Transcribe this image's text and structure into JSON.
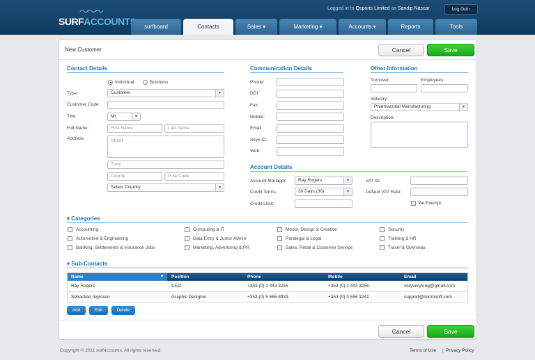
{
  "brand": {
    "name_a": "SURF",
    "name_b": "ACCOUNTS",
    "waves": "〜〜〜"
  },
  "header": {
    "logged_prefix": "Logged in to",
    "company": "Qsports Limited",
    "as_word": "as",
    "user": "Sandip Nascar",
    "logout": "Log Out ›"
  },
  "tabs": [
    {
      "label": "surfboard"
    },
    {
      "label": "Contacts"
    },
    {
      "label": "Sales ▾"
    },
    {
      "label": "Marketing ▾"
    },
    {
      "label": "Accounts ▾"
    },
    {
      "label": "Reports"
    },
    {
      "label": "Tools"
    }
  ],
  "page": {
    "title": "New Customer",
    "cancel": "Cancel",
    "save": "Save"
  },
  "contact": {
    "heading": "Contact Details",
    "individual": "Individual",
    "business": "Business",
    "type_label": "Type:",
    "type_value": "Customer",
    "code_label": "Customer Code:",
    "title_label": "Title:",
    "title_value": "Mr.",
    "fullname_label": "Full Name:",
    "first_ph": "First Name",
    "last_ph": "Last Name",
    "address_label": "Address:",
    "street_ph": "Street",
    "town_ph": "Town",
    "county_ph": "County",
    "postcode_ph": "Post Code",
    "country_value": "Select Country"
  },
  "comm": {
    "heading": "Communication Details",
    "phone": "Phone:",
    "ddi": "DDI:",
    "fax": "Fax:",
    "mobile": "Mobile:",
    "email": "Email:",
    "skype": "Skye ID:",
    "web": "Web:"
  },
  "other": {
    "heading": "Other Information",
    "turnover": "Turnover:",
    "employees": "Employees:",
    "industry_label": "Industry:",
    "industry_value": "Pharmacutial Manufacturing",
    "description": "Description:"
  },
  "account": {
    "heading": "Account Details",
    "manager_label": "Account Manager:",
    "manager_value": "Ray Rogers",
    "terms_label": "Credit Terms:",
    "terms_value": "30 Days (30)",
    "limit_label": "Credit Limit:",
    "vat_id": "VAT ID:",
    "vat_rate": "Default VAT Rate:",
    "vat_exempt": "Vat Exempt"
  },
  "categories": {
    "heading": "▾ Categories",
    "items": [
      "Accounting",
      "Automotive & Engineering",
      "Banking, Settlements & Insurance Jobs",
      "Computing & IT",
      "Data Entry & Junior Admin",
      "Marketing, Advertising & PR",
      "Media, Design & Creative",
      "Paralegal & Legal",
      "Sales, Retail & Customer Service",
      "Security",
      "Training & HR",
      "Travel & Overseas"
    ]
  },
  "subcontacts": {
    "heading": "▾ Sub-Contacts",
    "columns": [
      "Name",
      "Position",
      "Phone",
      "Mobile",
      "Email"
    ],
    "rows": [
      [
        "Ray Rogers",
        "CEO",
        "+353 (0) 1 443 3256",
        "+353 (0) 1 443 3256",
        "veryverylong@gmail.com"
      ],
      [
        "Sebastian Ingrosso",
        "Graphic Designer",
        "+353 (0) 5 666 8933",
        "+353 (0) 3 556 1241",
        "support@microsoft.com"
      ]
    ],
    "add": "Add",
    "edit": "Edit",
    "delete": "Delete"
  },
  "footer": {
    "copyright": "Copyright © 2011 surfaccounts. All rights reserved",
    "terms": "Terms of Use",
    "sep": "|",
    "privacy": "Privacy Policy"
  }
}
